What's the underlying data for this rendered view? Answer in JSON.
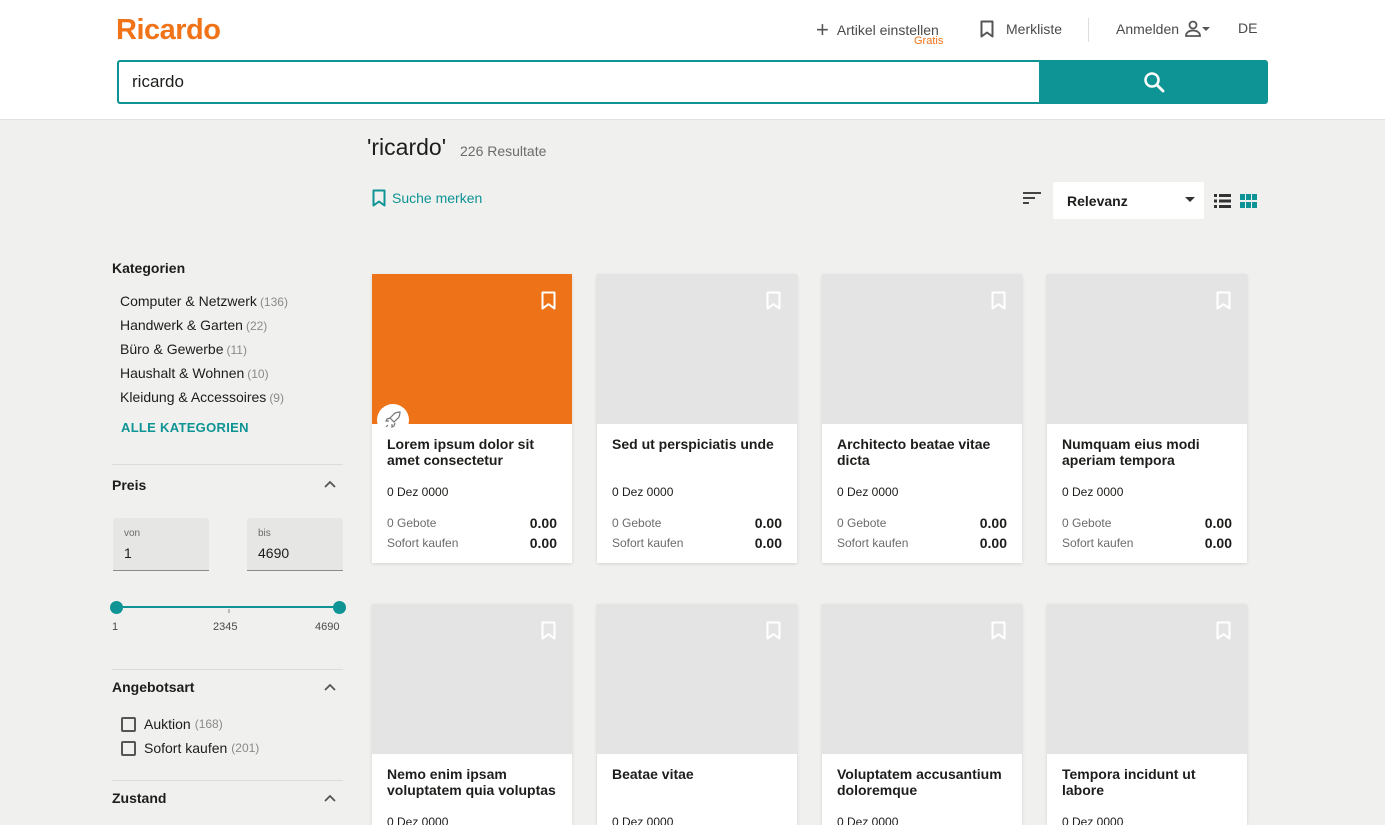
{
  "header": {
    "logo": "Ricardo",
    "sell_label": "Artikel einstellen",
    "sell_sub": "Gratis",
    "watchlist_label": "Merkliste",
    "login_label": "Anmelden",
    "language": "DE"
  },
  "search": {
    "value": "ricardo"
  },
  "results": {
    "query": "'ricardo'",
    "count": "226 Resultate",
    "save_search": "Suche merken",
    "sort_selected": "Relevanz"
  },
  "sidebar": {
    "categories_title": "Kategorien",
    "categories": [
      {
        "label": "Computer & Netzwerk",
        "count": "(136)"
      },
      {
        "label": "Handwerk & Garten",
        "count": "(22)"
      },
      {
        "label": "Büro & Gewerbe",
        "count": "(11)"
      },
      {
        "label": "Haushalt & Wohnen",
        "count": "(10)"
      },
      {
        "label": "Kleidung & Accessoires",
        "count": "(9)"
      }
    ],
    "all_categories": "ALLE KATEGORIEN",
    "price_title": "Preis",
    "price_from_label": "von",
    "price_from": "1",
    "price_to_label": "bis",
    "price_to": "4690",
    "slider_min": "1",
    "slider_mid": "2345",
    "slider_max": "4690",
    "offer_title": "Angebotsart",
    "offers": [
      {
        "label": "Auktion",
        "count": "(168)"
      },
      {
        "label": "Sofort kaufen",
        "count": "(201)"
      }
    ],
    "condition_title": "Zustand"
  },
  "cards": [
    {
      "title": "Lorem ipsum dolor sit amet consectetur",
      "date": "0 Dez 0000",
      "bids": "0 Gebote",
      "bid_price": "0.00",
      "buy_label": "Sofort kaufen",
      "buy_price": "0.00"
    },
    {
      "title": "Sed ut perspiciatis unde",
      "date": "0 Dez 0000",
      "bids": "0 Gebote",
      "bid_price": "0.00",
      "buy_label": "Sofort kaufen",
      "buy_price": "0.00"
    },
    {
      "title": "Architecto beatae vitae dicta",
      "date": "0 Dez 0000",
      "bids": "0 Gebote",
      "bid_price": "0.00",
      "buy_label": "Sofort kaufen",
      "buy_price": "0.00"
    },
    {
      "title": "Numquam eius modi aperiam tempora",
      "date": "0 Dez 0000",
      "bids": "0 Gebote",
      "bid_price": "0.00",
      "buy_label": "Sofort kaufen",
      "buy_price": "0.00"
    },
    {
      "title": "Nemo enim ipsam voluptatem quia voluptas",
      "date": "0 Dez 0000"
    },
    {
      "title": "Beatae vitae",
      "date": "0 Dez 0000"
    },
    {
      "title": "Voluptatem accusantium doloremque",
      "date": "0 Dez 0000"
    },
    {
      "title": "Tempora incidunt ut labore",
      "date": "0 Dez 0000"
    }
  ],
  "colors": {
    "brand": "#f07318",
    "accent": "#0e9494",
    "featured_image": "#ee7318"
  }
}
